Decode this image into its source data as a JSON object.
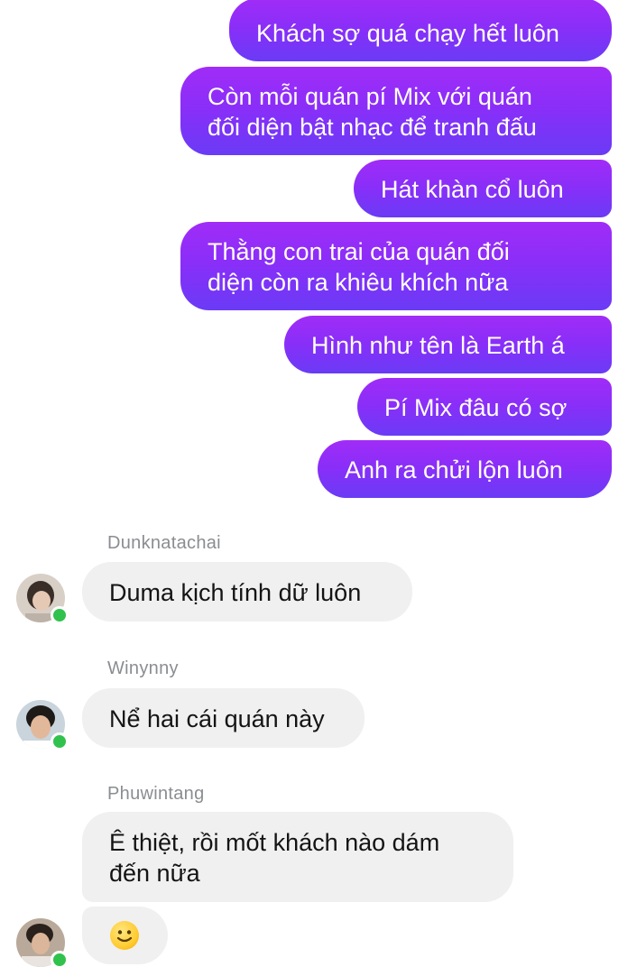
{
  "outgoing": [
    {
      "lines": [
        "Khách sợ quá chạy hết luôn"
      ]
    },
    {
      "lines": [
        "Còn mỗi quán pí Mix với quán",
        "đối diện bật nhạc để tranh đấu"
      ]
    },
    {
      "lines": [
        "Hát khàn cổ luôn"
      ]
    },
    {
      "lines": [
        "Thằng con trai của quán đối",
        "diện còn ra khiêu khích nữa"
      ]
    },
    {
      "lines": [
        "Hình như tên là Earth á"
      ]
    },
    {
      "lines": [
        "Pí Mix đâu có sợ"
      ]
    },
    {
      "lines": [
        "Anh ra chửi lộn luôn"
      ]
    }
  ],
  "incoming": [
    {
      "sender": "Dunknatachai",
      "lines": [
        "Duma kịch tính dữ luôn"
      ]
    },
    {
      "sender": "Winynny",
      "lines": [
        "Nể hai cái quán này"
      ]
    },
    {
      "sender": "Phuwintang",
      "lines": [
        "Ê thiệt, rồi mốt khách nào dám",
        "đến nữa"
      ]
    }
  ],
  "reaction": {
    "icon": "slightly-smiling-face-emoji"
  },
  "colors": {
    "outgoing_top": "#a12cf7",
    "outgoing_bottom": "#6a3bf6",
    "incoming_bg": "#f0f0f1",
    "online_dot": "#31c24d"
  }
}
